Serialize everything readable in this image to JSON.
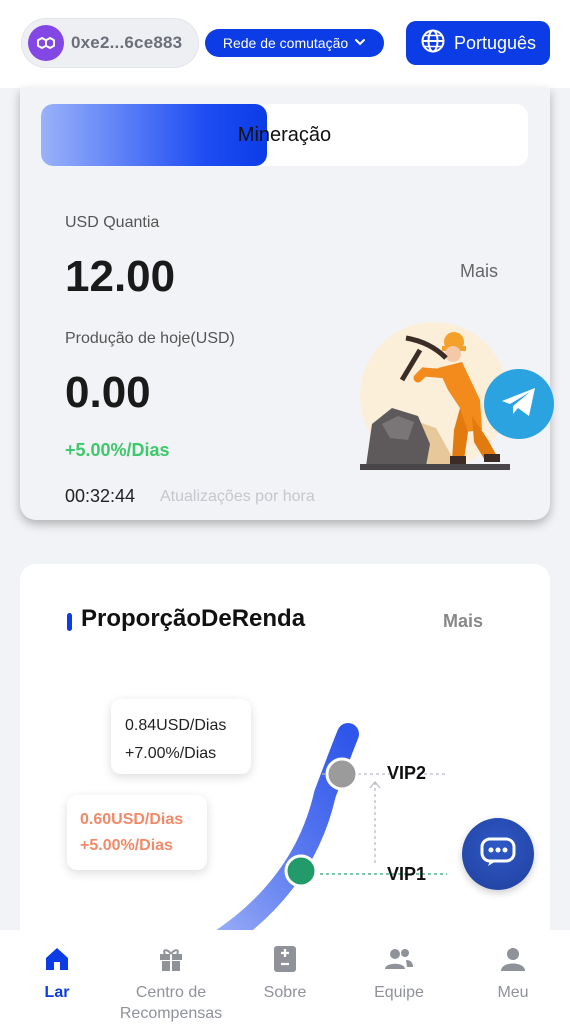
{
  "header": {
    "wallet_address": "0xe2...6ce883",
    "network_label": "Rede de comutação",
    "language_label": "Português"
  },
  "mining": {
    "tab_label": "Mineração",
    "usd_label": "USD Quantia",
    "usd_value": "12.00",
    "more_label": "Mais",
    "production_label": "Produção de hoje(USD)",
    "production_value": "0.00",
    "rate": "+5.00%/Dias",
    "timer": "00:32:44",
    "updates_label": "Atualizações por hora"
  },
  "income": {
    "title": "ProporçãoDeRenda",
    "more_label": "Mais",
    "levels": [
      {
        "name": "VIP1",
        "income": "0.60USD/Dias",
        "rate": "+5.00%/Dias"
      },
      {
        "name": "VIP2",
        "income": "0.84USD/Dias",
        "rate": "+7.00%/Dias"
      }
    ]
  },
  "nav": {
    "items": [
      {
        "label": "Lar",
        "icon": "home-icon",
        "active": true
      },
      {
        "label": "Centro de Recompensas",
        "icon": "gift-icon",
        "active": false
      },
      {
        "label": "Sobre",
        "icon": "about-icon",
        "active": false
      },
      {
        "label": "Equipe",
        "icon": "team-icon",
        "active": false
      },
      {
        "label": "Meu",
        "icon": "user-icon",
        "active": false
      }
    ]
  },
  "colors": {
    "primary": "#0b3ce6",
    "green": "#3ec86c",
    "orange": "#f08a6a",
    "telegram": "#2aa3e0",
    "polygon": "#8247e5"
  }
}
